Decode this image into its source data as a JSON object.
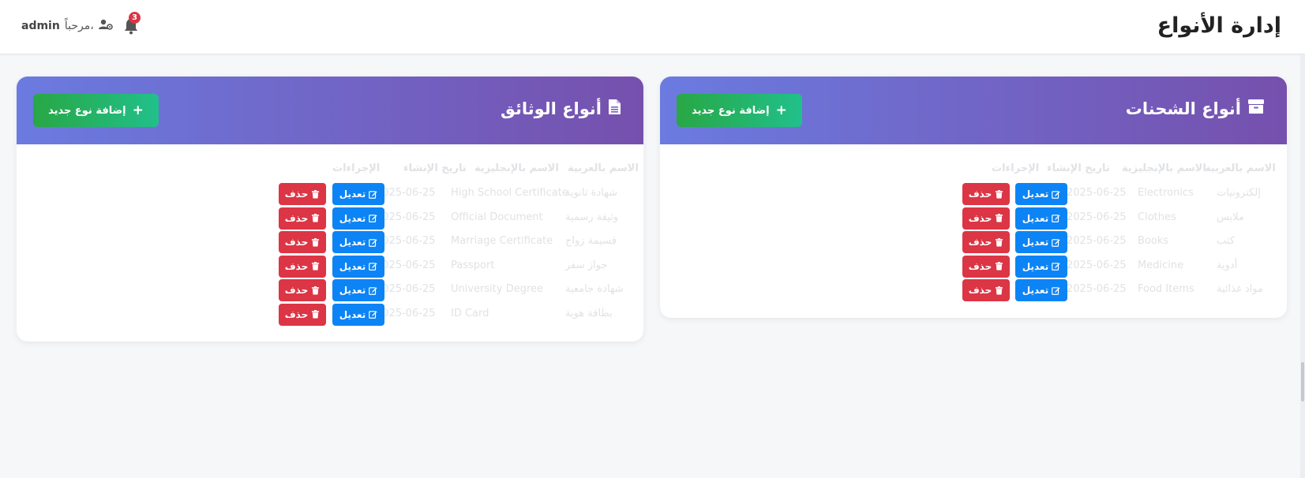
{
  "header": {
    "title": "إدارة الأنواع",
    "user_name": "admin",
    "greeting": "مرحباً،",
    "notification_count": "3"
  },
  "shipments": {
    "title": "أنواع الشحنات",
    "add_label": "إضافة نوع جديد",
    "columns": [
      "الاسم بالعربية",
      "الاسم بالإنجليزية",
      "تاريخ الإنشاء",
      "الإجراءات"
    ],
    "rows": [
      {
        "ar": "إلكترونيات",
        "en": "Electronics",
        "date": "2025-06-25"
      },
      {
        "ar": "ملابس",
        "en": "Clothes",
        "date": "2025-06-25"
      },
      {
        "ar": "كتب",
        "en": "Books",
        "date": "2025-06-25"
      },
      {
        "ar": "أدوية",
        "en": "Medicine",
        "date": "2025-06-25"
      },
      {
        "ar": "مواد غذائية",
        "en": "Food Items",
        "date": "2025-06-25"
      }
    ],
    "edit_label": "تعديل",
    "delete_label": "حذف"
  },
  "documents": {
    "title": "أنواع الوثائق",
    "add_label": "إضافة نوع جديد",
    "columns": [
      "الاسم بالعربية",
      "الاسم بالإنجليزية",
      "تاريخ الإنشاء",
      "الإجراءات"
    ],
    "rows": [
      {
        "ar": "شهادة ثانوية",
        "en": "High School Certificate",
        "date": "2025-06-25"
      },
      {
        "ar": "وثيقة رسمية",
        "en": "Official Document",
        "date": "2025-06-25"
      },
      {
        "ar": "قسيمة زواج",
        "en": "Marriage Certificate",
        "date": "2025-06-25"
      },
      {
        "ar": "جواز سفر",
        "en": "Passport",
        "date": "2025-06-25"
      },
      {
        "ar": "شهادة جامعية",
        "en": "University Degree",
        "date": "2025-06-25"
      },
      {
        "ar": "بطاقة هوية",
        "en": "ID Card",
        "date": "2025-06-25"
      }
    ],
    "edit_label": "تعديل",
    "delete_label": "حذف"
  },
  "colors": {
    "header_gradient_start": "#6b7be0",
    "header_gradient_end": "#7650ad",
    "add_button": "#28a745",
    "edit_button": "#0d84f5",
    "delete_button": "#dc3545",
    "badge": "#dc3545"
  }
}
